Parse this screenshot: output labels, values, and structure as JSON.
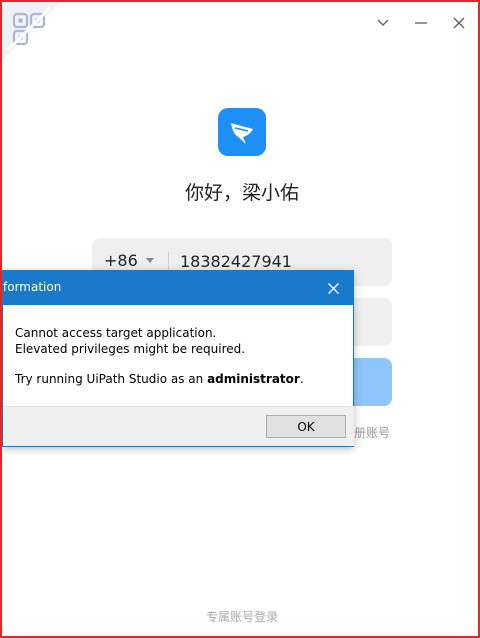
{
  "window": {
    "controls": [
      "chevron-down-icon",
      "minimize-icon",
      "close-icon"
    ]
  },
  "qr_corner": {
    "icon": "qr-code-icon"
  },
  "app": {
    "logo_icon": "dingtalk-logo-icon",
    "brand_color": "#1e8ff7",
    "greeting": "你好，梁小佑"
  },
  "phone": {
    "country_code": "+86",
    "number": "18382427941"
  },
  "login": {
    "button_color": "#8ec6fb"
  },
  "links": {
    "register": "册账号",
    "exclusive_login": "专属账号登录"
  },
  "dialog": {
    "title": "formation",
    "line1": "Cannot access target application.",
    "line2": "Elevated privileges might be required.",
    "line3_prefix": "Try running UiPath Studio as an ",
    "line3_bold": "administrator",
    "line3_suffix": ".",
    "ok_label": "OK",
    "accent": "#1979ca"
  }
}
